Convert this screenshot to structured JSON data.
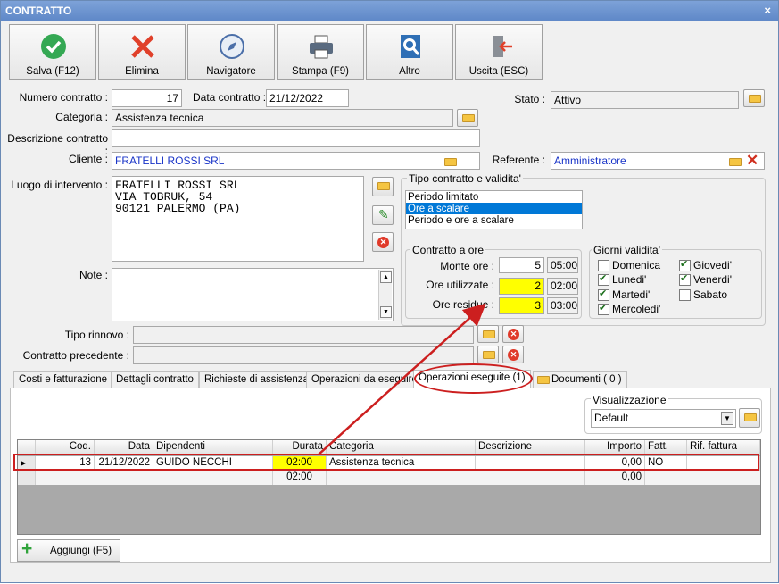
{
  "window": {
    "title": "CONTRATTO",
    "close": "×"
  },
  "toolbar": {
    "save": "Salva (F12)",
    "delete": "Elimina",
    "navigator": "Navigatore",
    "print": "Stampa (F9)",
    "other": "Altro",
    "exit": "Uscita (ESC)"
  },
  "form": {
    "numero_label": "Numero contratto :",
    "numero_value": "17",
    "data_label": "Data contratto :",
    "data_value": "21/12/2022",
    "stato_label": "Stato :",
    "stato_value": "Attivo",
    "categoria_label": "Categoria :",
    "categoria_value": "Assistenza tecnica",
    "descrizione_label": "Descrizione contratto :",
    "descrizione_value": "",
    "cliente_label": "Cliente :",
    "cliente_value": "FRATELLI ROSSI SRL",
    "referente_label": "Referente :",
    "referente_value": "Amministratore",
    "luogo_label": "Luogo di intervento :",
    "luogo_lines": [
      "FRATELLI ROSSI SRL",
      "VIA TOBRUK, 54",
      "90121 PALERMO (PA)"
    ],
    "note_label": "Note :",
    "rinnovo_label": "Tipo rinnovo :",
    "precedente_label": "Contratto precedente :"
  },
  "tipo": {
    "title": "Tipo contratto e validita'",
    "options": [
      "Periodo limitato",
      "Ore a scalare",
      "Periodo e ore a scalare"
    ],
    "selected": 1
  },
  "ore": {
    "title": "Contratto a ore",
    "monte_label": "Monte ore :",
    "monte_value": "5",
    "monte_time": "05:00",
    "util_label": "Ore utilizzate :",
    "util_value": "2",
    "util_time": "02:00",
    "res_label": "Ore residue :",
    "res_value": "3",
    "res_time": "03:00"
  },
  "giorni": {
    "title": "Giorni validita'",
    "days": [
      {
        "label": "Domenica",
        "on": false
      },
      {
        "label": "Lunedi'",
        "on": true
      },
      {
        "label": "Martedi'",
        "on": true
      },
      {
        "label": "Mercoledi'",
        "on": true
      },
      {
        "label": "Giovedi'",
        "on": true
      },
      {
        "label": "Venerdi'",
        "on": true
      },
      {
        "label": "Sabato",
        "on": false
      }
    ]
  },
  "tabs": [
    "Costi e fatturazione",
    "Dettagli contratto",
    "Richieste di assistenza",
    "Operazioni da eseguire",
    "Operazioni eseguite (1)",
    "Documenti ( 0 )"
  ],
  "visual": {
    "title": "Visualizzazione",
    "value": "Default"
  },
  "grid": {
    "headers": [
      "Cod.",
      "Data",
      "Dipendenti",
      "Durata",
      "Categoria",
      "Descrizione",
      "Importo",
      "Fatt.",
      "Rif. fattura"
    ],
    "row": {
      "cod": "13",
      "data": "21/12/2022",
      "dip": "GUIDO NECCHI",
      "durata": "02:00",
      "cat": "Assistenza tecnica",
      "desc": "",
      "imp": "0,00",
      "fatt": "NO",
      "rif": ""
    },
    "total": {
      "durata": "02:00",
      "imp": "0,00"
    }
  },
  "add_button": "Aggiungi (F5)"
}
